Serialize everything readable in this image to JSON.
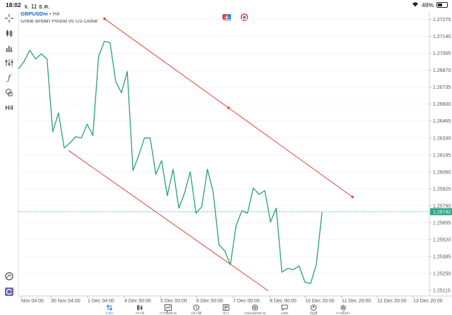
{
  "status_bar": {
    "time": "18:02",
    "date": "จ. 11 ธ.ค.",
    "battery": "49%"
  },
  "symbol": {
    "name": "GBPUSDm",
    "timeframe": "• H4",
    "description": "Great Britain Pound vs US Dollar"
  },
  "toolbar": {
    "items": [
      "crosshair-icon",
      "candle-type-icon",
      "volume-bars-icon",
      "indicators-icon",
      "function-icon",
      "objects-icon"
    ],
    "timeframe_label": "H4"
  },
  "colors": {
    "price_line": "#26a27b",
    "trend_line": "#e0453a",
    "current_price_bg": "#2fa68a",
    "active_tab": "#1976d2"
  },
  "price_axis": {
    "ticks": [
      "1.27275",
      "1.27140",
      "1.27005",
      "1.26870",
      "1.26735",
      "1.26600",
      "1.26465",
      "1.26330",
      "1.26195",
      "1.26060",
      "1.25925",
      "1.25790",
      "1.25655",
      "1.25520",
      "1.25385",
      "1.25250",
      "1.25115"
    ],
    "current_price": "1.25742"
  },
  "time_axis": {
    "ticks": [
      "Nov 04:00",
      "30 Nov 04:00",
      "1 Dec 04:00",
      "4 Dec 00:00",
      "5 Dec 00:00",
      "6 Dec 00:00",
      "7 Dec 00:00",
      "8 Dec 00:00",
      "10 Dec 20:00",
      "11 Dec 20:00",
      "12 Dec 20:00",
      "13 Dec 20:00"
    ]
  },
  "chart_data": {
    "type": "line",
    "symbol": "GBPUSDm",
    "timeframe": "H4",
    "ylim": [
      1.2507,
      1.2734
    ],
    "points": [
      1.2688,
      1.2694,
      1.2703,
      1.2696,
      1.27,
      1.2696,
      1.2638,
      1.2653,
      1.2625,
      1.2629,
      1.2634,
      1.2633,
      1.2644,
      1.2635,
      1.2698,
      1.271,
      1.2709,
      1.2678,
      1.2669,
      1.2686,
      1.2607,
      1.2619,
      1.2633,
      1.2633,
      1.2604,
      1.2615,
      1.2587,
      1.2608,
      1.2577,
      1.2589,
      1.2606,
      1.2573,
      1.2578,
      1.2608,
      1.259,
      1.2548,
      1.2543,
      1.2532,
      1.2563,
      1.2575,
      1.2573,
      1.2593,
      1.2588,
      1.2591,
      1.2566,
      1.2577,
      1.2526,
      1.2529,
      1.2528,
      1.2531,
      1.2518,
      1.2517,
      1.2532,
      1.2574
    ],
    "trend_lines": [
      {
        "from_price": 1.2728,
        "to_price": 1.2586
      },
      {
        "from_price": 1.2623,
        "to_price": 1.2511
      }
    ]
  },
  "bottom_nav": {
    "items": [
      {
        "label": "ราคา",
        "icon": "quotes-icon",
        "active": true
      },
      {
        "label": "กราฟ",
        "icon": "chart-icon",
        "active": false
      },
      {
        "label": "การซื้อขาย",
        "icon": "trade-icon",
        "active": false
      },
      {
        "label": "ประวัติ",
        "icon": "history-icon",
        "active": false
      },
      {
        "label": "ข่าว",
        "icon": "news-icon",
        "active": false
      },
      {
        "label": "กล่องจดหมาย",
        "icon": "mailbox-icon",
        "active": false
      },
      {
        "label": "แชท",
        "icon": "chat-icon",
        "active": false
      },
      {
        "label": "บัญชี",
        "icon": "account-icon",
        "active": false
      },
      {
        "label": "การตั้งค่า",
        "icon": "settings-icon",
        "active": false
      }
    ]
  }
}
